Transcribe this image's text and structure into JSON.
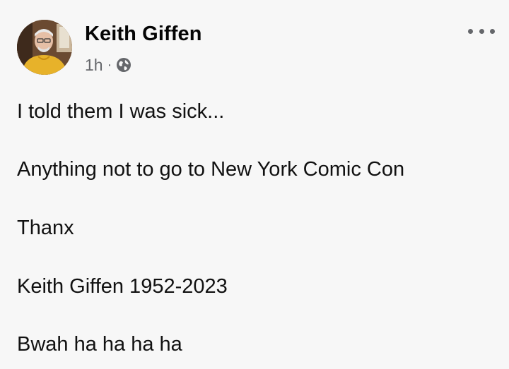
{
  "post": {
    "author_name": "Keith Giffen",
    "timestamp": "1h",
    "separator": "·",
    "audience_icon": "globe-icon",
    "more_icon": "more-options-icon",
    "lines": [
      "I told them I was sick...",
      "Anything not to go to New York Comic Con",
      "Thanx",
      "Keith Giffen 1952-2023",
      "Bwah ha ha ha ha"
    ]
  }
}
